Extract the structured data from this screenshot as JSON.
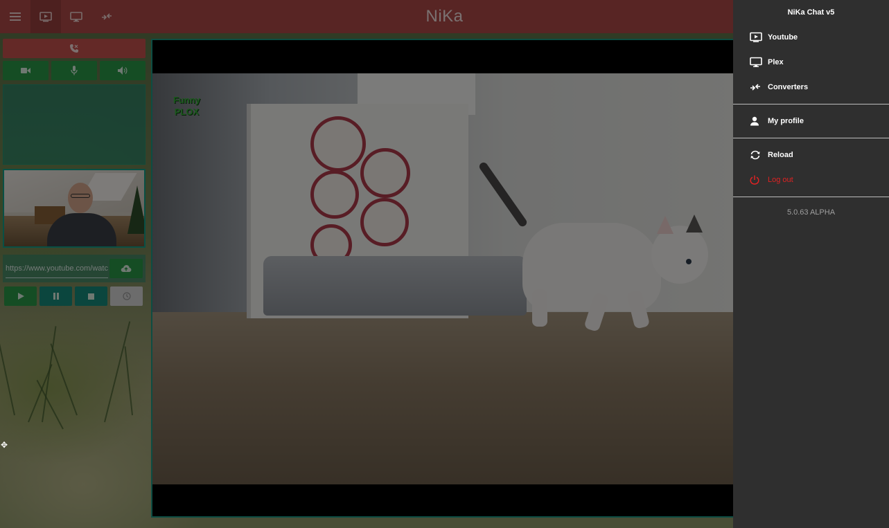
{
  "app": {
    "title": "NiKa"
  },
  "toolbar": {
    "menu_icon": "menu-icon",
    "youtube_icon": "youtube-icon",
    "plex_icon": "monitor-icon",
    "converters_icon": "converters-icon"
  },
  "left_panel": {
    "url_input_value": "https://www.youtube.com/watch"
  },
  "player": {
    "watermark_line1": "Funny",
    "watermark_line2": "PLOX"
  },
  "drawer": {
    "title": "NiKa Chat v5",
    "items": [
      {
        "label": "Youtube",
        "icon": "youtube-icon"
      },
      {
        "label": "Plex",
        "icon": "monitor-icon"
      },
      {
        "label": "Converters",
        "icon": "converters-icon"
      }
    ],
    "profile_label": "My profile",
    "reload_label": "Reload",
    "logout_label": "Log out",
    "version": "5.0.63 ALPHA"
  },
  "colors": {
    "appbar": "#b04b48",
    "accent_green": "#2b9a48",
    "accent_teal": "#168c7c",
    "call_red": "#c9534f",
    "logout_red": "#e02222",
    "drawer_bg": "#2f2f2f"
  }
}
